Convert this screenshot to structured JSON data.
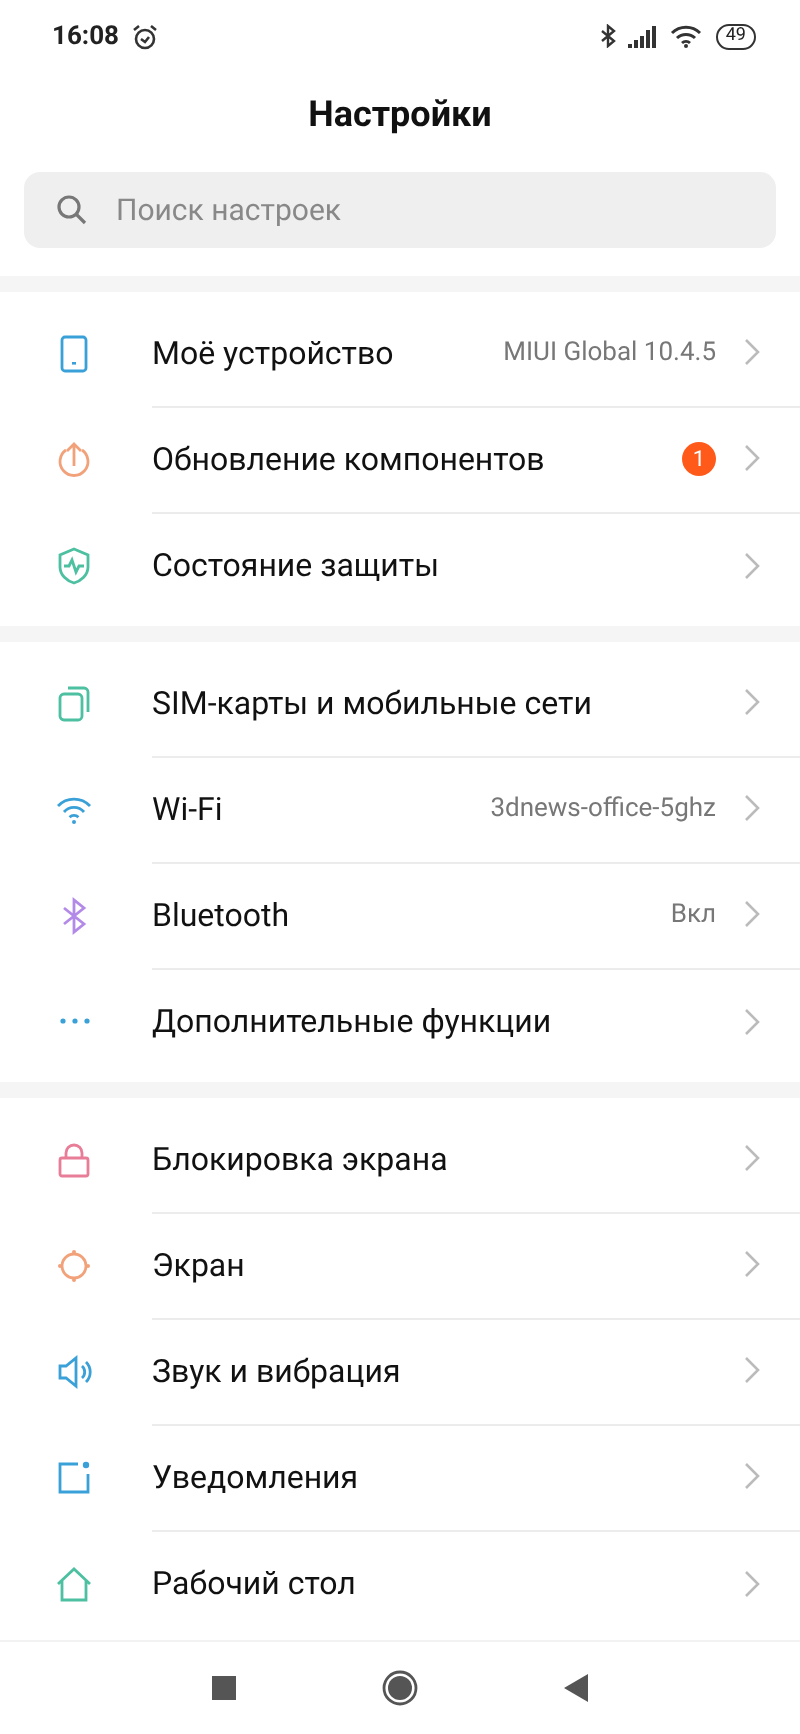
{
  "status_bar": {
    "time": "16:08",
    "battery": "49"
  },
  "title": "Настройки",
  "search": {
    "placeholder": "Поиск настроек"
  },
  "groups": [
    {
      "items": [
        {
          "label": "Моё устройство",
          "value": "MIUI Global 10.4.5"
        },
        {
          "label": "Обновление компонентов",
          "badge": "1"
        },
        {
          "label": "Состояние защиты"
        }
      ]
    },
    {
      "items": [
        {
          "label": "SIM-карты и мобильные сети"
        },
        {
          "label": "Wi-Fi",
          "value": "3dnews-office-5ghz"
        },
        {
          "label": "Bluetooth",
          "value": "Вкл"
        },
        {
          "label": "Дополнительные функции"
        }
      ]
    },
    {
      "items": [
        {
          "label": "Блокировка экрана"
        },
        {
          "label": "Экран"
        },
        {
          "label": "Звук и вибрация"
        },
        {
          "label": "Уведомления"
        },
        {
          "label": "Рабочий стол"
        }
      ]
    }
  ]
}
